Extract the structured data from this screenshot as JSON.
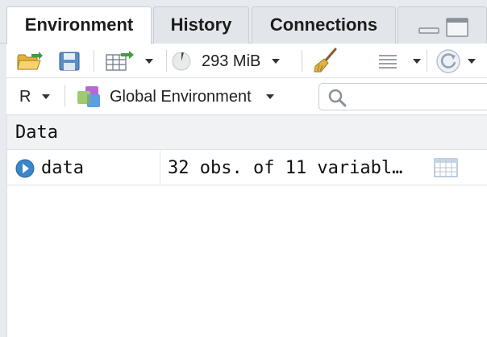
{
  "tabs": [
    {
      "label": "Environment",
      "active": true
    },
    {
      "label": "History",
      "active": false
    },
    {
      "label": "Connections",
      "active": false
    }
  ],
  "toolbar": {
    "memory_label": "293 MiB",
    "icons": [
      "open-folder-icon",
      "save-icon",
      "import-dataset-icon",
      "memory-pie-icon",
      "broom-icon",
      "list-view-icon",
      "refresh-icon"
    ]
  },
  "env_bar": {
    "language": "R",
    "environment": "Global Environment",
    "search_placeholder": ""
  },
  "data_section": {
    "header": "Data",
    "rows": [
      {
        "name": "data",
        "value": "32 obs. of 11 variabl…"
      }
    ]
  },
  "colors": {
    "accent_blue": "#3a86c8",
    "tab_bg": "#e2e5e9",
    "header_bg": "#f0f2f4"
  }
}
